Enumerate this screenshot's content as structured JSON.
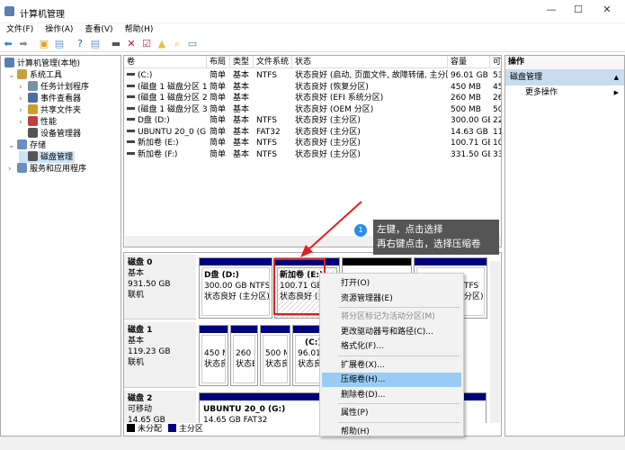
{
  "window": {
    "title": "计算机管理",
    "minimize": "—",
    "maximize": "☐",
    "close": "✕"
  },
  "menu": [
    "文件(F)",
    "操作(A)",
    "查看(V)",
    "帮助(H)"
  ],
  "toolbar": [
    {
      "icon": "back-icon",
      "glyph": "⬅",
      "color": "#2a7fd4"
    },
    {
      "icon": "forward-icon",
      "glyph": "➡",
      "color": "#888"
    },
    {
      "icon": "up-folder-icon",
      "glyph": "▣",
      "color": "#d9a520"
    },
    {
      "icon": "show-hide-tree-icon",
      "glyph": "▤",
      "color": "#6a9ccf"
    },
    {
      "icon": "help-icon",
      "glyph": "?",
      "color": "#1e5eb8"
    },
    {
      "icon": "show-hide-action-icon",
      "glyph": "▤",
      "color": "#6a9ccf"
    },
    {
      "icon": "connect-icon",
      "glyph": "▬",
      "color": "#555"
    },
    {
      "icon": "delete-icon",
      "glyph": "✕",
      "color": "#d01010"
    },
    {
      "icon": "check-icon",
      "glyph": "☑",
      "color": "#c03030"
    },
    {
      "icon": "folder-up-icon",
      "glyph": "▲",
      "color": "#e8c030"
    },
    {
      "icon": "folder-search-icon",
      "glyph": "⌕",
      "color": "#e8c030"
    },
    {
      "icon": "properties-icon",
      "glyph": "▭",
      "color": "#5577aa"
    }
  ],
  "tree": [
    {
      "label": "计算机管理(本地)",
      "level": 0,
      "icon": "computer-icon"
    },
    {
      "label": "系统工具",
      "level": 1,
      "icon": "tools-icon",
      "expander": "⌄"
    },
    {
      "label": "任务计划程序",
      "level": 2,
      "icon": "clock-icon",
      "expander": "›"
    },
    {
      "label": "事件查看器",
      "level": 2,
      "icon": "event-viewer-icon",
      "expander": "›"
    },
    {
      "label": "共享文件夹",
      "level": 2,
      "icon": "shared-folder-icon",
      "expander": "›"
    },
    {
      "label": "性能",
      "level": 2,
      "icon": "performance-icon",
      "expander": "›"
    },
    {
      "label": "设备管理器",
      "level": 2,
      "icon": "device-manager-icon"
    },
    {
      "label": "存储",
      "level": 1,
      "icon": "storage-icon",
      "expander": "⌄"
    },
    {
      "label": "磁盘管理",
      "level": 2,
      "icon": "disk-management-icon",
      "selected": true
    },
    {
      "label": "服务和应用程序",
      "level": 1,
      "icon": "services-icon",
      "expander": "›"
    }
  ],
  "volumes": {
    "headers": [
      "卷",
      "布局",
      "类型",
      "文件系统",
      "状态",
      "容量",
      "可"
    ],
    "rows": [
      [
        "(C:)",
        "简单",
        "基本",
        "NTFS",
        "状态良好 (启动, 页面文件, 故障转储, 主分区)",
        "96.01 GB",
        "53"
      ],
      [
        "(磁盘 1 磁盘分区 1)",
        "简单",
        "基本",
        "",
        "状态良好 (恢复分区)",
        "450 MB",
        "45"
      ],
      [
        "(磁盘 1 磁盘分区 2)",
        "简单",
        "基本",
        "",
        "状态良好 (EFI 系统分区)",
        "260 MB",
        "26"
      ],
      [
        "(磁盘 1 磁盘分区 3)",
        "简单",
        "基本",
        "",
        "状态良好 (OEM 分区)",
        "500 MB",
        "50"
      ],
      [
        "D盘 (D:)",
        "简单",
        "基本",
        "NTFS",
        "状态良好 (主分区)",
        "300.00 GB",
        "22"
      ],
      [
        "UBUNTU 20_0 (G:)",
        "简单",
        "基本",
        "FAT32",
        "状态良好 (主分区)",
        "14.63 GB",
        "11"
      ],
      [
        "新加卷 (E:)",
        "简单",
        "基本",
        "NTFS",
        "状态良好 (主分区)",
        "100.71 GB",
        "10"
      ],
      [
        "新加卷 (F:)",
        "简单",
        "基本",
        "NTFS",
        "状态良好 (主分区)",
        "331.50 GB",
        "33"
      ]
    ]
  },
  "disks": [
    {
      "name": "磁盘 0",
      "type": "基本",
      "size": "931.50 GB",
      "status": "联机"
    },
    {
      "name": "磁盘 1",
      "type": "基本",
      "size": "119.23 GB",
      "status": "联机"
    },
    {
      "name": "磁盘 2",
      "type": "可移动",
      "size": "14.65 GB"
    }
  ],
  "partitions": {
    "d": {
      "name": "D盘  (D:)",
      "size": "300.00 GB NTFS",
      "status": "状态良好 (主分区)"
    },
    "e": {
      "name": "新加卷  (E:)",
      "size": "100.71 GB N",
      "status": "状态良好 (主"
    },
    "f": {
      "size": "TFS",
      "status": "分区)"
    },
    "p1": {
      "size": "450 M",
      "status": "状态良"
    },
    "p2": {
      "size": "260 M",
      "status": "状态E"
    },
    "p3": {
      "size": "500 M",
      "status": "状态良"
    },
    "c": {
      "name": "(C:)",
      "size": "96.01",
      "status": "状态良"
    },
    "g": {
      "name": "UBUNTU 20_0  (G:)",
      "size": "14.65 GB FAT32"
    }
  },
  "legend": [
    {
      "label": "未分配",
      "color": "#000000"
    },
    {
      "label": "主分区",
      "color": "#00007f"
    }
  ],
  "actions": {
    "title": "操作",
    "section": "磁盘管理",
    "item": "更多操作"
  },
  "context_menu": [
    {
      "label": "打开(O)"
    },
    {
      "label": "资源管理器(E)"
    },
    {
      "sep": true
    },
    {
      "label": "将分区标记为活动分区(M)",
      "disabled": true
    },
    {
      "label": "更改驱动器号和路径(C)..."
    },
    {
      "label": "格式化(F)..."
    },
    {
      "sep": true
    },
    {
      "label": "扩展卷(X)..."
    },
    {
      "label": "压缩卷(H)...",
      "highlighted": true
    },
    {
      "label": "删除卷(D)..."
    },
    {
      "sep": true
    },
    {
      "label": "属性(P)"
    },
    {
      "sep": true
    },
    {
      "label": "帮助(H)"
    }
  ],
  "annotation": {
    "badge": "1",
    "line1": "左键，点击选择",
    "line2": "再右键点击，选择压缩卷",
    "color": "#e02020"
  },
  "colors": {
    "primary_partition": "#00007f",
    "unallocated": "#000000",
    "highlight": "#99ccf5",
    "action_header": "#c9dcef"
  }
}
